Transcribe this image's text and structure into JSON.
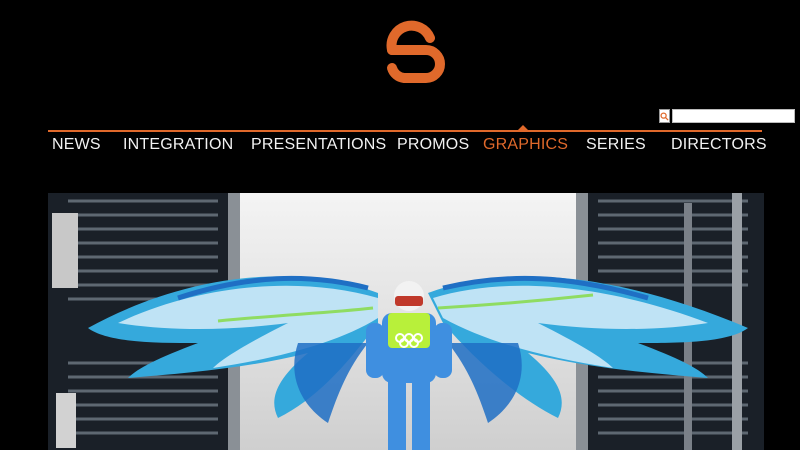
{
  "brand": {
    "accent_color": "#e0692b",
    "logo_icon": "c-brand-logo-icon"
  },
  "search": {
    "value": "",
    "icon": "search-icon"
  },
  "nav": {
    "items": [
      {
        "label": "NEWS",
        "active": false
      },
      {
        "label": "INTEGRATION",
        "active": false
      },
      {
        "label": "PRESENTATIONS",
        "active": false
      },
      {
        "label": "PROMOS",
        "active": false
      },
      {
        "label": "GRAPHICS",
        "active": true
      },
      {
        "label": "SERIES",
        "active": false
      },
      {
        "label": "DIRECTORS",
        "active": false
      }
    ]
  },
  "hero": {
    "alt": "Ski jumper with animated blue wings graphic",
    "badge_icon": "olympic-rings-icon",
    "colors": {
      "wing_light": "#bfe3f5",
      "wing_mid": "#35a9dc",
      "wing_dark": "#1f6fc4",
      "wing_green": "#8fdc62"
    }
  }
}
